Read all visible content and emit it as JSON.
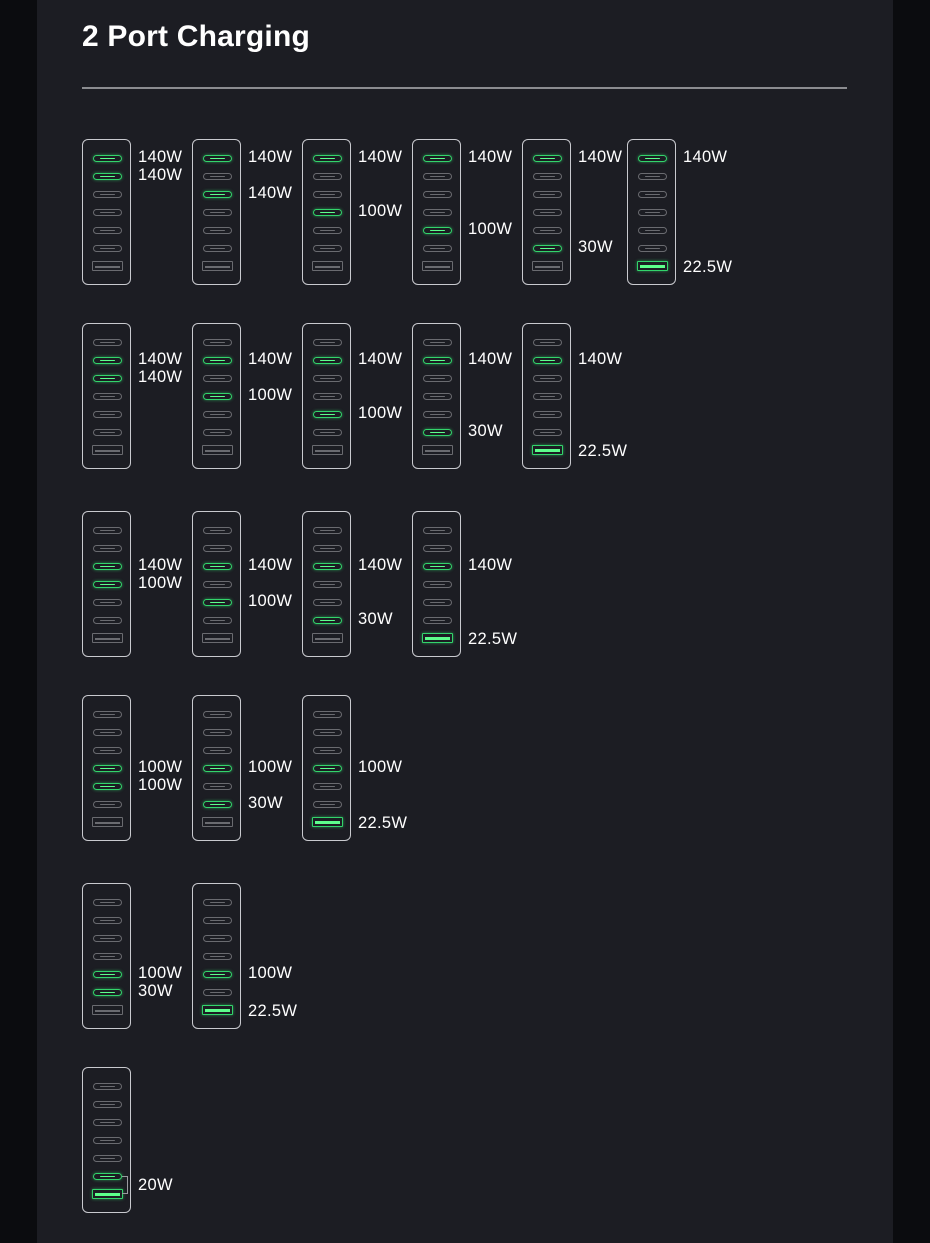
{
  "title": "2 Port Charging",
  "colors": {
    "background": "#1c1d23",
    "active_port": "#33d46b",
    "inactive_port": "#6a6b70",
    "text": "#ffffff"
  },
  "port_layout": [
    "USB-C1",
    "USB-C2",
    "USB-C3",
    "USB-C4",
    "USB-C5",
    "USB-C6",
    "USB-A"
  ],
  "configs": [
    {
      "active": [
        0,
        1
      ],
      "labels": [
        "140W",
        "140W"
      ]
    },
    {
      "active": [
        0,
        2
      ],
      "labels": [
        "140W",
        "140W"
      ]
    },
    {
      "active": [
        0,
        3
      ],
      "labels": [
        "140W",
        "100W"
      ]
    },
    {
      "active": [
        0,
        4
      ],
      "labels": [
        "140W",
        "100W"
      ]
    },
    {
      "active": [
        0,
        5
      ],
      "labels": [
        "140W",
        "30W"
      ]
    },
    {
      "active": [
        0,
        6
      ],
      "labels": [
        "140W",
        "22.5W"
      ]
    },
    {
      "active": [
        1,
        2
      ],
      "labels": [
        "140W",
        "140W"
      ]
    },
    {
      "active": [
        1,
        3
      ],
      "labels": [
        "140W",
        "100W"
      ]
    },
    {
      "active": [
        1,
        4
      ],
      "labels": [
        "140W",
        "100W"
      ]
    },
    {
      "active": [
        1,
        5
      ],
      "labels": [
        "140W",
        "30W"
      ]
    },
    {
      "active": [
        1,
        6
      ],
      "labels": [
        "140W",
        "22.5W"
      ]
    },
    {
      "active": [
        2,
        3
      ],
      "labels": [
        "140W",
        "100W"
      ]
    },
    {
      "active": [
        2,
        4
      ],
      "labels": [
        "140W",
        "100W"
      ]
    },
    {
      "active": [
        2,
        5
      ],
      "labels": [
        "140W",
        "30W"
      ]
    },
    {
      "active": [
        2,
        6
      ],
      "labels": [
        "140W",
        "22.5W"
      ]
    },
    {
      "active": [
        3,
        4
      ],
      "labels": [
        "100W",
        "100W"
      ]
    },
    {
      "active": [
        3,
        5
      ],
      "labels": [
        "100W",
        "30W"
      ]
    },
    {
      "active": [
        3,
        6
      ],
      "labels": [
        "100W",
        "22.5W"
      ]
    },
    {
      "active": [
        4,
        5
      ],
      "labels": [
        "100W",
        "30W"
      ]
    },
    {
      "active": [
        4,
        6
      ],
      "labels": [
        "100W",
        "22.5W"
      ]
    },
    {
      "active": [
        5,
        6
      ],
      "labels": [
        "20W"
      ],
      "shared": true
    }
  ]
}
